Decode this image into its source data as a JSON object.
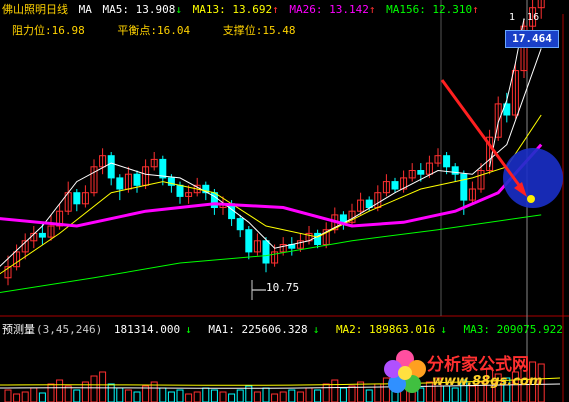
{
  "header": {
    "stock_name": "佛山照明",
    "period": "日线",
    "ma_label": "MA",
    "ma5": "MA5: 13.908",
    "ma5_arrow": "↓",
    "ma13": "MA13: 13.692",
    "ma13_arrow": "↑",
    "ma26": "MA26: 13.142",
    "ma26_arrow": "↑",
    "ma156": "MA156: 12.310",
    "ma156_arrow": "↑"
  },
  "levels": {
    "resistance": "阻力位:16.98",
    "balance": "平衡点:16.04",
    "support": "支撑位:15.48"
  },
  "price_badge": "17.464",
  "corner_readout": "1 .16",
  "low_label": "10.75",
  "volume_header": {
    "title": "预测量",
    "params": "(3,45,246)",
    "value": "181314.000",
    "value_arrow": "↓",
    "ma1": "MA1: 225606.328",
    "ma1_arrow": "↓",
    "ma2": "MA2: 189863.016",
    "ma2_arrow": "↓",
    "ma3": "MA3: 209075.922",
    "ma3_arrow": "↑"
  },
  "watermark": {
    "cn": "分析家公式网",
    "url": "www.88gs.com"
  },
  "colors": {
    "background": "#000000",
    "up_candle": "#ff3030",
    "down_candle": "#00ffff",
    "ma5": "#ffffff",
    "ma13": "#ffff00",
    "ma26": "#ff00ff",
    "ma156": "#00ff00",
    "annotation_arrow": "#ff2020",
    "highlight_circle": "#1a2fc8"
  }
}
